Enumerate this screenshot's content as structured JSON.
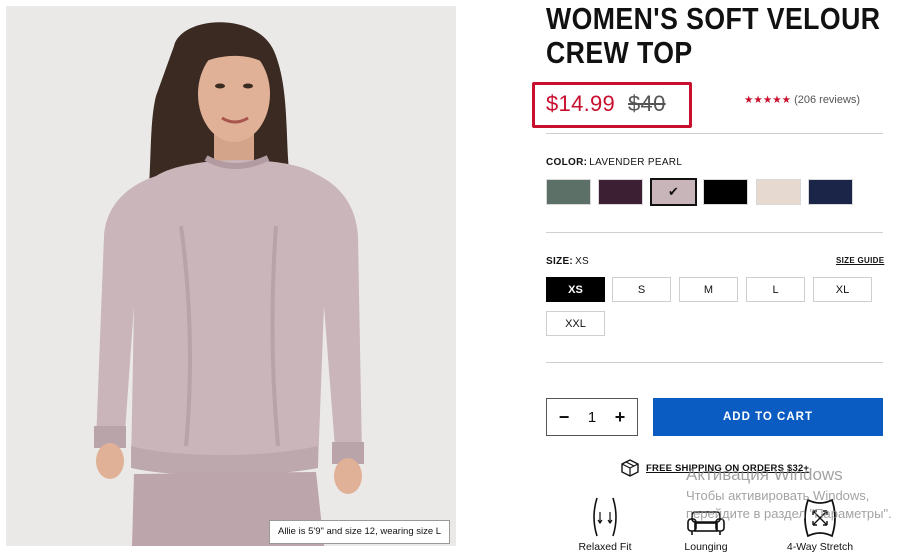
{
  "product": {
    "title_line1": "WOMEN'S SOFT VELOUR",
    "title_line2": "CREW TOP",
    "price_sale": "$14.99",
    "price_original": "$40",
    "stars": "★★★★★",
    "reviews": "(206 reviews)",
    "image_caption": "Allie is 5'9\" and size 12, wearing size L"
  },
  "color": {
    "label": "COLOR:",
    "selected": "LAVENDER PEARL",
    "swatches": [
      {
        "name": "slate green",
        "hex": "#5d7068"
      },
      {
        "name": "plum",
        "hex": "#3d1f33"
      },
      {
        "name": "lavender pearl",
        "hex": "#c8b5b9",
        "selected": true
      },
      {
        "name": "black",
        "hex": "#000000"
      },
      {
        "name": "oatmeal",
        "hex": "#e6dad0"
      },
      {
        "name": "navy",
        "hex": "#1b2548"
      }
    ]
  },
  "size": {
    "label": "SIZE:",
    "selected": "XS",
    "guide_label": "SIZE GUIDE",
    "options": [
      "XS",
      "S",
      "M",
      "L",
      "XL",
      "XXL"
    ]
  },
  "quantity": {
    "value": "1",
    "minus": "−",
    "plus": "+"
  },
  "cart": {
    "add_label": "ADD TO CART"
  },
  "shipping": {
    "label": "FREE SHIPPING ON ORDERS $32+"
  },
  "features": [
    {
      "label": "Relaxed Fit",
      "icon": "relaxed-fit-icon"
    },
    {
      "label": "Lounging",
      "icon": "sofa-icon"
    },
    {
      "label": "4-Way Stretch",
      "icon": "stretch-icon"
    }
  ],
  "os_watermark": {
    "line1": "Активация Windows",
    "line2": "Чтобы активировать Windows,",
    "line3": "перейдите в раздел \"Параметры\"."
  },
  "colors": {
    "sale_red": "#c8102e",
    "cart_blue": "#0b5cc2"
  }
}
